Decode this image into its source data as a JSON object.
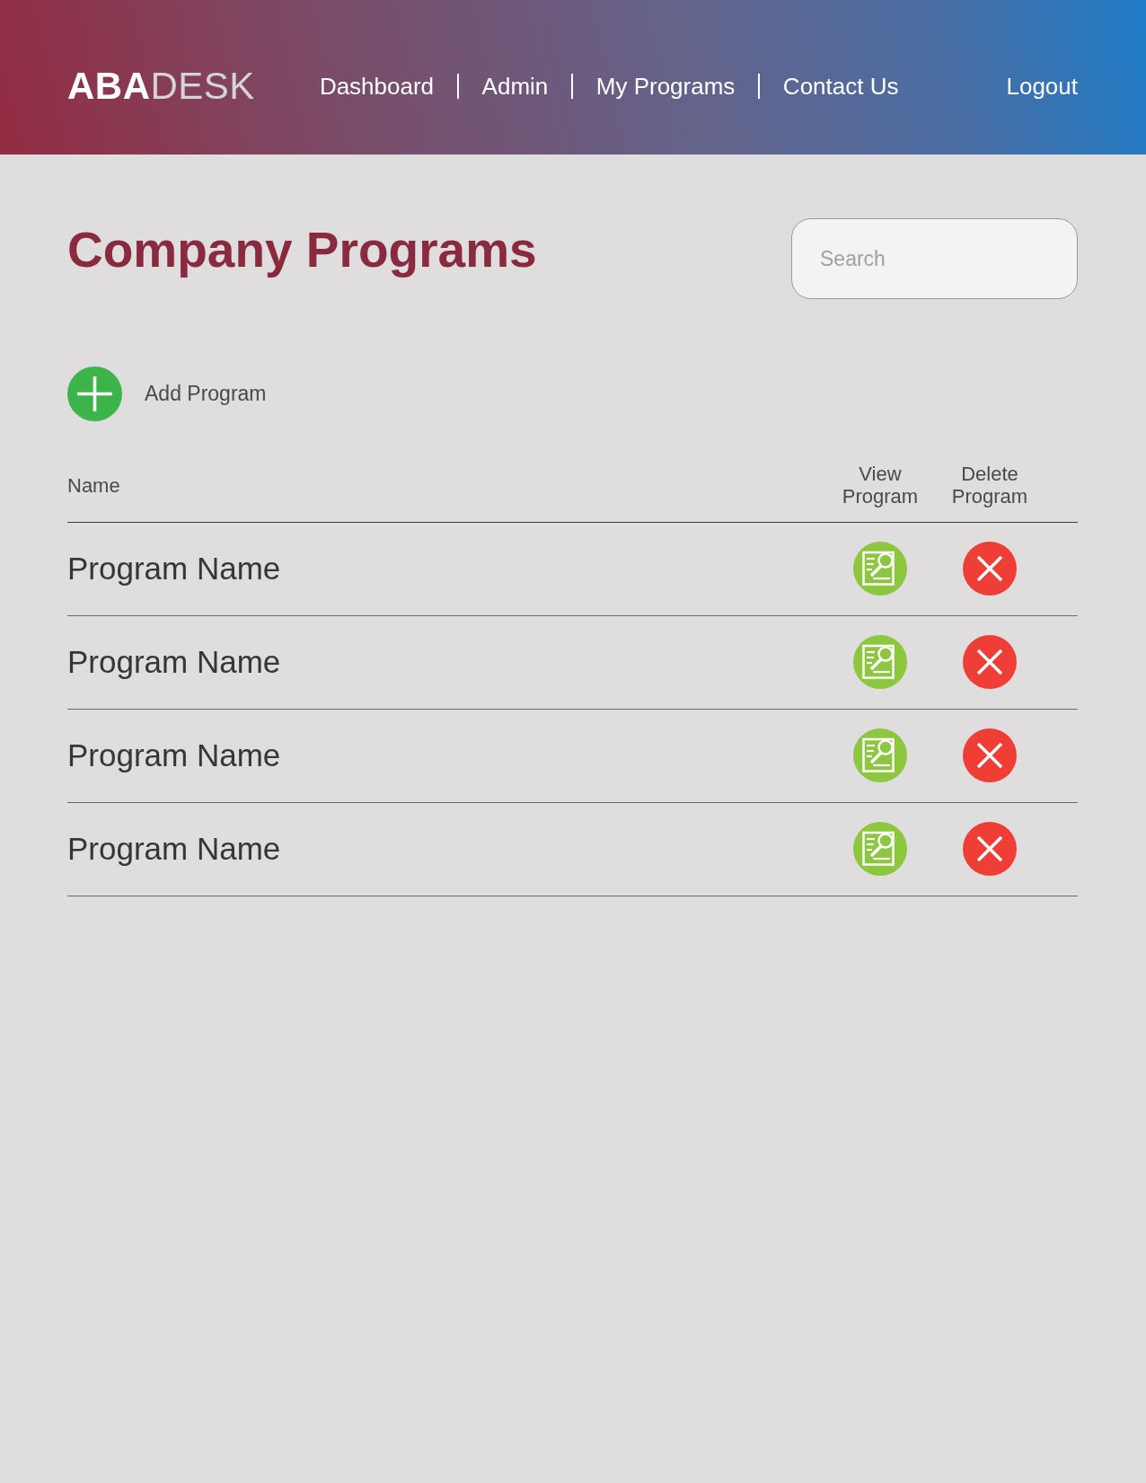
{
  "header": {
    "logo": "**ABA**DESK",
    "nav": [
      {
        "label": "Dashboard"
      },
      {
        "label": "Admin"
      },
      {
        "label": "My Programs"
      },
      {
        "label": "Contact Us"
      }
    ],
    "logout": "Logout"
  },
  "page": {
    "title": "Company Programs",
    "search": {
      "placeholder": "Search"
    },
    "add_button": {
      "label": "Add Program"
    }
  },
  "table": {
    "columns": [
      "Name",
      "View Program",
      "Delete Program"
    ],
    "rows": [
      {
        "name": "Program Name"
      },
      {
        "name": "Program Name"
      },
      {
        "name": "Program Name"
      },
      {
        "name": "Program Name"
      }
    ]
  }
}
